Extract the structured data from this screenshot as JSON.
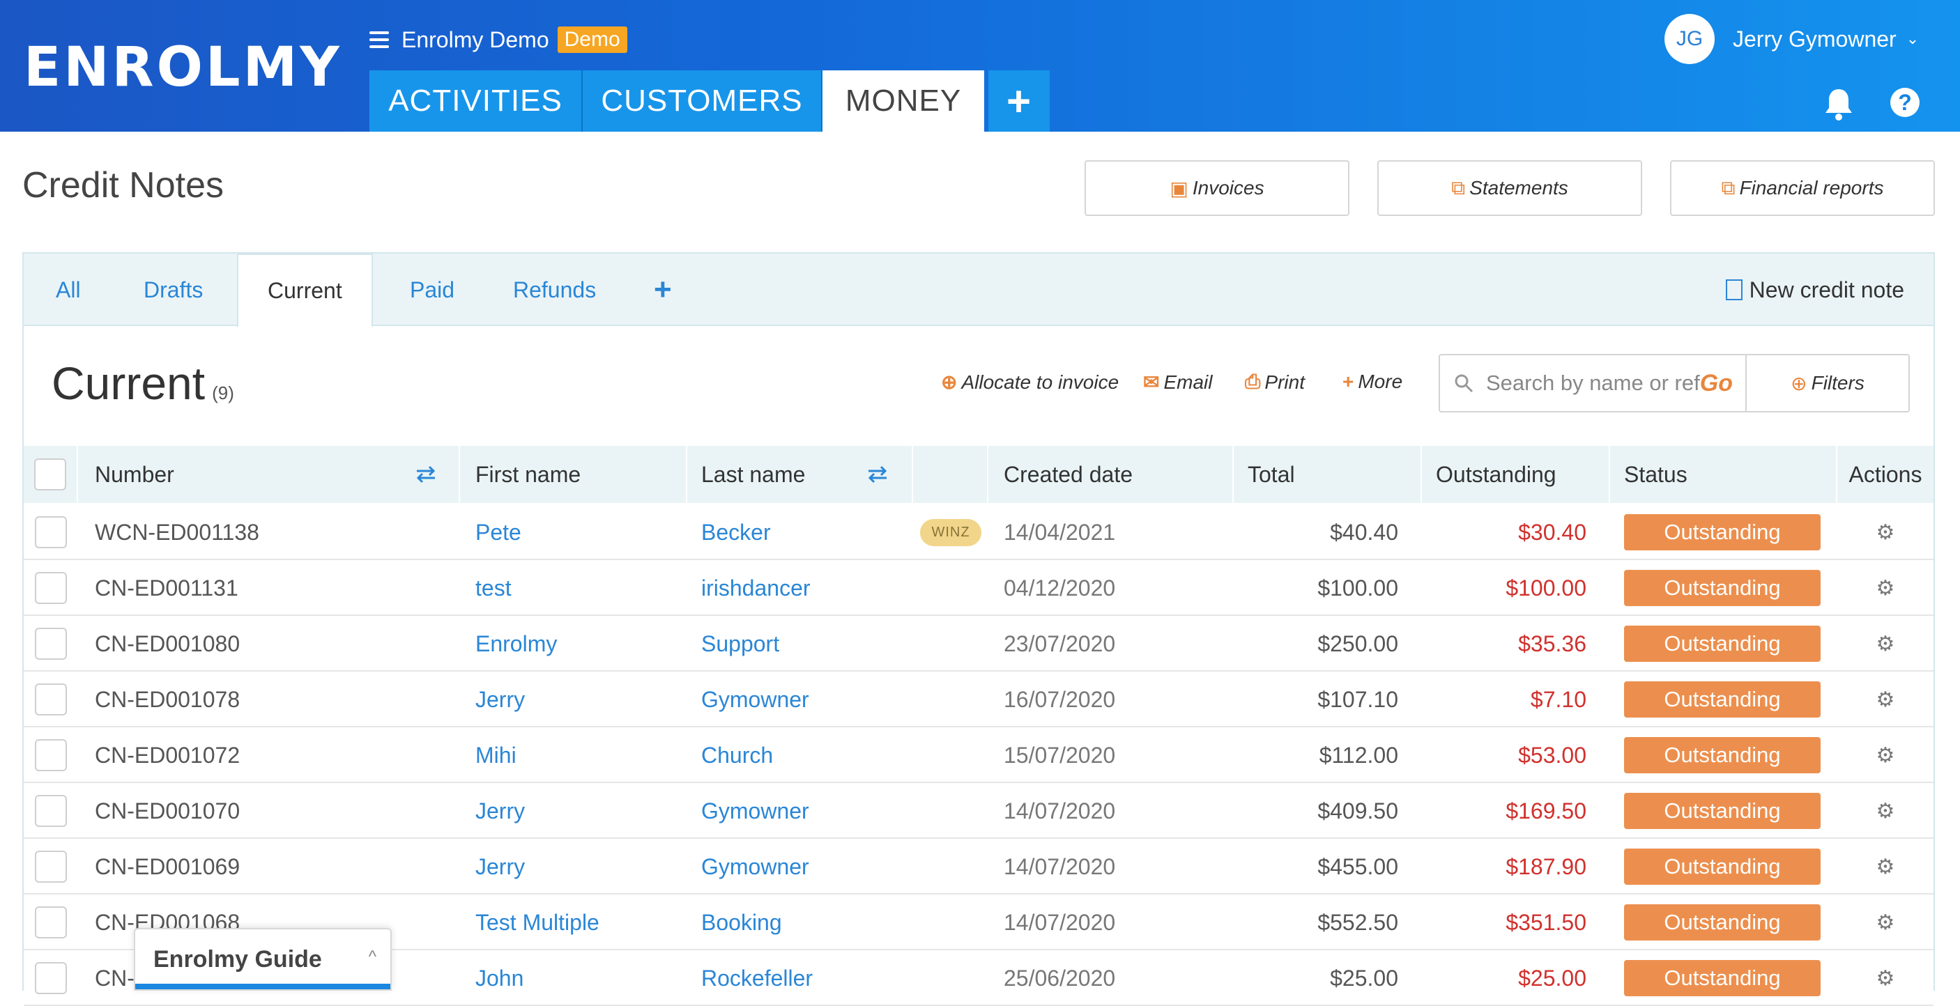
{
  "brand": {
    "logo": "ENROLMY"
  },
  "org": {
    "name": "Enrolmy Demo",
    "badge": "Demo"
  },
  "nav": {
    "activities": "ACTIVITIES",
    "customers": "CUSTOMERS",
    "money": "MONEY",
    "add": "+"
  },
  "user": {
    "initials": "JG",
    "name": "Jerry Gymowner",
    "chevron": "⌄"
  },
  "header_icons": {
    "help": "?"
  },
  "page": {
    "title": "Credit Notes"
  },
  "top_buttons": {
    "invoices": "Invoices",
    "statements": "Statements",
    "reports": "Financial reports"
  },
  "subtabs": {
    "all": "All",
    "drafts": "Drafts",
    "current": "Current",
    "paid": "Paid",
    "refunds": "Refunds",
    "add": "+",
    "new_credit_note": "New credit note"
  },
  "section": {
    "title": "Current",
    "count": "(9)"
  },
  "toolbar": {
    "allocate": "Allocate to invoice",
    "email": "Email",
    "print": "Print",
    "more": "More",
    "search_placeholder": "Search by name or ref",
    "go": "Go",
    "filters": "Filters"
  },
  "table": {
    "headers": {
      "number": "Number",
      "first_name": "First name",
      "last_name": "Last name",
      "created_date": "Created date",
      "total": "Total",
      "outstanding": "Outstanding",
      "status": "Status",
      "actions": "Actions"
    },
    "rows": [
      {
        "number": "WCN-ED001138",
        "first": "Pete",
        "last": "Becker",
        "tag": "WINZ",
        "date": "14/04/2021",
        "total": "$40.40",
        "outstanding": "$30.40",
        "status": "Outstanding"
      },
      {
        "number": "CN-ED001131",
        "first": "test",
        "last": "irishdancer",
        "tag": "",
        "date": "04/12/2020",
        "total": "$100.00",
        "outstanding": "$100.00",
        "status": "Outstanding"
      },
      {
        "number": "CN-ED001080",
        "first": "Enrolmy",
        "last": "Support",
        "tag": "",
        "date": "23/07/2020",
        "total": "$250.00",
        "outstanding": "$35.36",
        "status": "Outstanding"
      },
      {
        "number": "CN-ED001078",
        "first": "Jerry",
        "last": "Gymowner",
        "tag": "",
        "date": "16/07/2020",
        "total": "$107.10",
        "outstanding": "$7.10",
        "status": "Outstanding"
      },
      {
        "number": "CN-ED001072",
        "first": "Mihi",
        "last": "Church",
        "tag": "",
        "date": "15/07/2020",
        "total": "$112.00",
        "outstanding": "$53.00",
        "status": "Outstanding"
      },
      {
        "number": "CN-ED001070",
        "first": "Jerry",
        "last": "Gymowner",
        "tag": "",
        "date": "14/07/2020",
        "total": "$409.50",
        "outstanding": "$169.50",
        "status": "Outstanding"
      },
      {
        "number": "CN-ED001069",
        "first": "Jerry",
        "last": "Gymowner",
        "tag": "",
        "date": "14/07/2020",
        "total": "$455.00",
        "outstanding": "$187.90",
        "status": "Outstanding"
      },
      {
        "number": "CN-ED001068",
        "first": "Test Multiple",
        "last": "Booking",
        "tag": "",
        "date": "14/07/2020",
        "total": "$552.50",
        "outstanding": "$351.50",
        "status": "Outstanding"
      },
      {
        "number": "CN-",
        "first": "John",
        "last": "Rockefeller",
        "tag": "",
        "date": "25/06/2020",
        "total": "$25.00",
        "outstanding": "$25.00",
        "status": "Outstanding"
      }
    ]
  },
  "guide": {
    "title": "Enrolmy Guide",
    "chevron": "^"
  },
  "colors": {
    "brand_blue": "#1468d8",
    "accent_orange": "#e8863c",
    "status_orange": "#ec8f4e",
    "negative_red": "#d0312d",
    "link_blue": "#2a86d6"
  }
}
